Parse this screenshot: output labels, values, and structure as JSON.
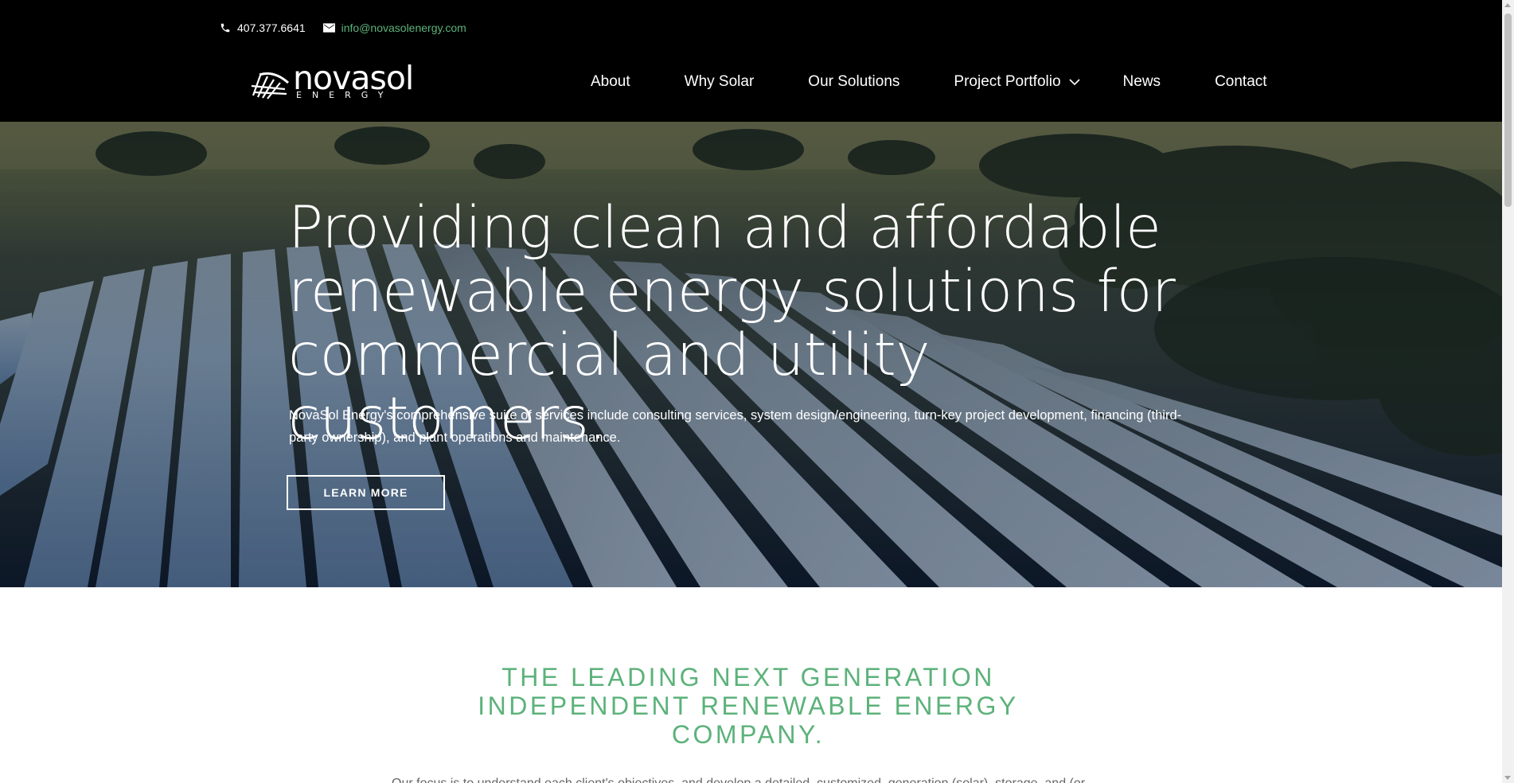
{
  "topbar": {
    "phone": "407.377.6641",
    "email": "info@novasolenergy.com",
    "phone_icon": "phone-icon",
    "email_icon": "envelope-icon"
  },
  "logo": {
    "name": "novasol",
    "tagline": "ENERGY"
  },
  "nav": {
    "items": [
      "About",
      "Why Solar",
      "Our Solutions",
      "Project Portfolio",
      "News",
      "Contact"
    ],
    "dropdown_icon": "chevron-down-icon"
  },
  "hero": {
    "title": "Providing clean and affordable renewable energy solutions for commercial and utility customers.",
    "description": "NovaSol Energy's comprehensive suite of services include consulting services, system design/engineering, turn-key project development, financing (third-party ownership), and plant operations and maintenance.",
    "button": "LEARN MORE"
  },
  "intro": {
    "heading": "THE LEADING NEXT GENERATION INDEPENDENT RENEWABLE ENERGY COMPANY.",
    "text": "Our focus is to understand each client's objectives, and develop a detailed, customized, generation (solar), storage, and (or"
  },
  "colors": {
    "accent_green": "#5cb27a",
    "header_bg": "#000000",
    "text_white": "#ffffff"
  }
}
